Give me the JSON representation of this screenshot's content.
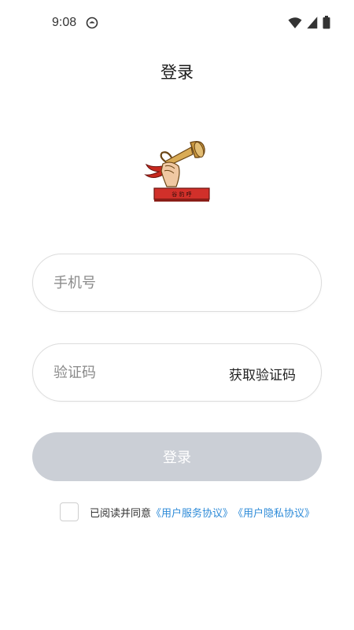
{
  "status_bar": {
    "time": "9:08",
    "icons": [
      "app-notification-icon",
      "wifi-icon",
      "signal-icon",
      "battery-icon"
    ]
  },
  "header": {
    "title": "登录"
  },
  "logo": {
    "name": "trumpet-logo-icon",
    "banner_text": "谷 豹 呼"
  },
  "form": {
    "phone": {
      "placeholder": "手机号",
      "value": ""
    },
    "code": {
      "placeholder": "验证码",
      "value": "",
      "get_code_label": "获取验证码"
    },
    "submit_label": "登录",
    "submit_enabled": false
  },
  "agreement": {
    "checked": false,
    "prefix": "已阅读并同意",
    "service_link": "《用户服务协议》",
    "privacy_link": "《用户隐私协议》"
  },
  "colors": {
    "link": "#2e8bd8",
    "disabled_button": "#cbcfd6",
    "field_border": "#dcdcdc"
  }
}
